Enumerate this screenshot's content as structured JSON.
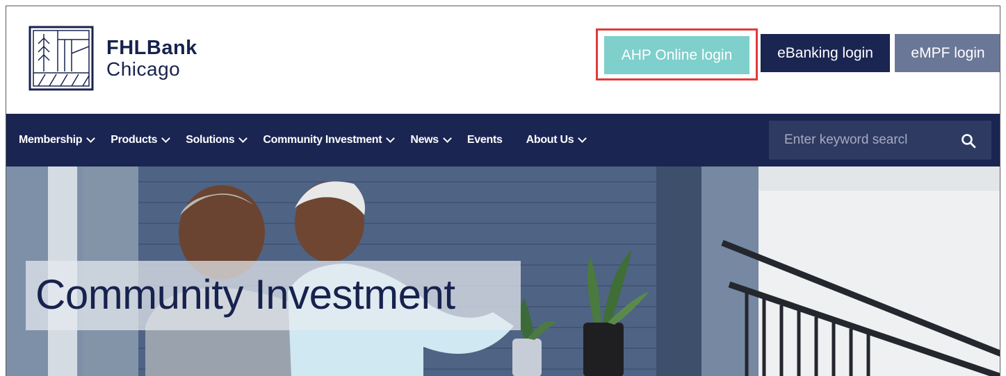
{
  "brand": {
    "line1": "FHLBank",
    "line2": "Chicago"
  },
  "logins": {
    "ahp": "AHP Online login",
    "ebanking": "eBanking login",
    "empf": "eMPF login"
  },
  "nav": {
    "items": [
      {
        "label": "Membership",
        "dropdown": true
      },
      {
        "label": "Products",
        "dropdown": true
      },
      {
        "label": "Solutions",
        "dropdown": true
      },
      {
        "label": "Community Investment",
        "dropdown": true
      },
      {
        "label": "News",
        "dropdown": true
      },
      {
        "label": "Events",
        "dropdown": false
      },
      {
        "label": "About Us",
        "dropdown": true
      }
    ]
  },
  "search": {
    "placeholder": "Enter keyword searcl"
  },
  "hero": {
    "title": "Community Investment"
  },
  "colors": {
    "navy": "#1a2552",
    "teal": "#7fcfcc",
    "slate": "#6a7797",
    "highlight": "#e03a3a"
  }
}
